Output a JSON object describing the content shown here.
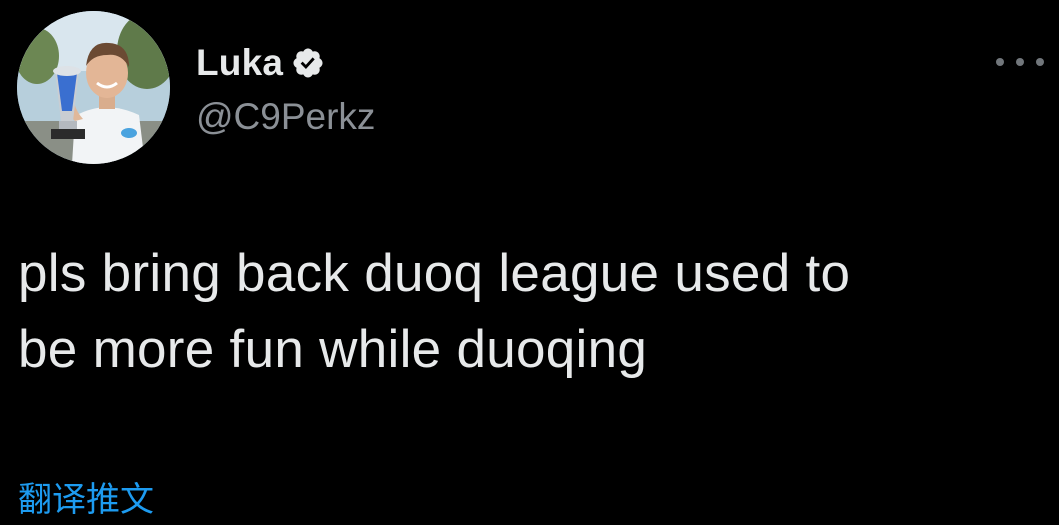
{
  "author": {
    "display_name": "Luka",
    "handle": "@C9Perkz",
    "verified": true,
    "avatar": "profile-photo-with-trophy"
  },
  "tweet": {
    "line1": "pls bring back duoq league used to",
    "line2": "be more fun while duoqing"
  },
  "actions": {
    "translate_label": "翻译推文",
    "more_icon": "ellipsis-icon"
  },
  "colors": {
    "background": "#000000",
    "text": "#e7e9ea",
    "secondary_text": "#8b9096",
    "link": "#1d9bf0"
  }
}
